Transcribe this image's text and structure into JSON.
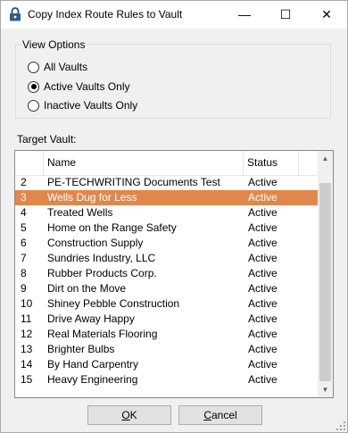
{
  "window": {
    "title": "Copy Index Route Rules to Vault",
    "icon": "lock-icon",
    "controls": {
      "minimize": "—",
      "maximize": "☐",
      "close": "✕"
    }
  },
  "view_options": {
    "label": "View Options",
    "options": [
      {
        "label": "All Vaults",
        "checked": false
      },
      {
        "label": "Active Vaults Only",
        "checked": true
      },
      {
        "label": "Inactive Vaults Only",
        "checked": false
      }
    ]
  },
  "target_vault": {
    "label": "Target Vault:",
    "columns": [
      "Name",
      "Status"
    ],
    "selected_index": 1,
    "selection_color": "#e0884b",
    "rows": [
      {
        "num": "2",
        "name": "PE-TECHWRITING Documents Test",
        "status": "Active"
      },
      {
        "num": "3",
        "name": "Wells Dug for Less",
        "status": "Active"
      },
      {
        "num": "4",
        "name": "Treated Wells",
        "status": "Active"
      },
      {
        "num": "5",
        "name": "Home on the Range Safety",
        "status": "Active"
      },
      {
        "num": "6",
        "name": "Construction Supply",
        "status": "Active"
      },
      {
        "num": "7",
        "name": "Sundries Industry, LLC",
        "status": "Active"
      },
      {
        "num": "8",
        "name": "Rubber Products Corp.",
        "status": "Active"
      },
      {
        "num": "9",
        "name": "Dirt on the Move",
        "status": "Active"
      },
      {
        "num": "10",
        "name": "Shiney Pebble Construction",
        "status": "Active"
      },
      {
        "num": "11",
        "name": "Drive Away Happy",
        "status": "Active"
      },
      {
        "num": "12",
        "name": "Real Materials Flooring",
        "status": "Active"
      },
      {
        "num": "13",
        "name": "Brighter Bulbs",
        "status": "Active"
      },
      {
        "num": "14",
        "name": "By Hand Carpentry",
        "status": "Active"
      },
      {
        "num": "15",
        "name": "Heavy Engineering",
        "status": "Active"
      }
    ]
  },
  "buttons": {
    "ok": {
      "access_key": "O",
      "rest": "K"
    },
    "cancel": {
      "access_key": "C",
      "rest": "ancel"
    }
  }
}
